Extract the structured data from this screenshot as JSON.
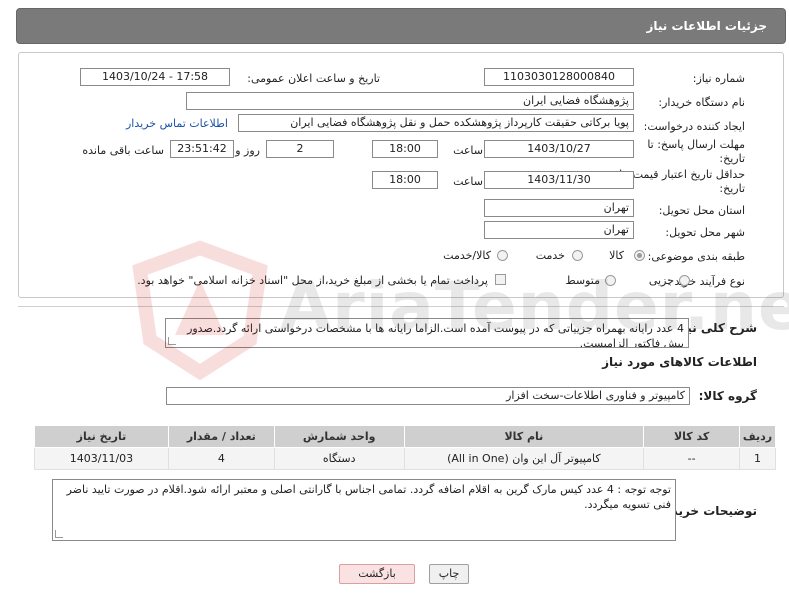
{
  "header": {
    "title": "جزئیات اطلاعات نیاز"
  },
  "fields": {
    "need_number_label": "شماره نیاز:",
    "need_number": "1103030128000840",
    "announce_label": "تاریخ و ساعت اعلان عمومی:",
    "announce_value": "1403/10/24 - 17:58",
    "buyer_label": "نام دستگاه خریدار:",
    "buyer_value": "پژوهشگاه فضایی ایران",
    "creator_label": "ایجاد کننده درخواست:",
    "creator_value": "پویا برکاتی حقیقت کارپرداز پژوهشکده حمل و نقل پژوهشگاه فضایی ایران",
    "contact_link": "اطلاعات تماس خریدار",
    "deadline_label_1": "مهلت ارسال پاسخ: تا",
    "deadline_label_2": "تاریخ:",
    "deadline_date": "1403/10/27",
    "time_label": "ساعت",
    "deadline_time": "18:00",
    "days_value": "2",
    "days_label": "روز و",
    "remaining_value": "23:51:42",
    "remaining_label": "ساعت باقی مانده",
    "validity_label_1": "حداقل تاریخ اعتبار قیمت: تا",
    "validity_label_2": "تاریخ:",
    "validity_date": "1403/11/30",
    "validity_time_label": "ساعت",
    "validity_time": "18:00",
    "province_label": "استان محل تحویل:",
    "province_value": "تهران",
    "city_label": "شهر محل تحویل:",
    "city_value": "تهران",
    "category_label": "طبقه بندی موضوعی:",
    "category_options": [
      "کالا",
      "خدمت",
      "کالا/خدمت"
    ],
    "process_label": "نوع فرآیند خرید :",
    "process_options": [
      "جزیی",
      "متوسط"
    ],
    "payment_note": "پرداخت تمام یا بخشی از مبلغ خرید،از محل \"اسناد خزانه اسلامی\" خواهد بود."
  },
  "description": {
    "label": "شرح کلی نیاز:",
    "text": "4 عدد رایانه بهمراه جزییاتی که در پیوست آمده است.الزاما رایانه ها با مشخصات درخواستی ارائه گردد.صدور پیش فاکتور الزامیست."
  },
  "goods": {
    "section_title": "اطلاعات کالاهای مورد نیاز",
    "group_label": "گروه کالا:",
    "group_value": "کامپیوتر و فناوری اطلاعات-سخت افزار",
    "columns": [
      "ردیف",
      "کد کالا",
      "نام کالا",
      "واحد شمارش",
      "تعداد / مقدار",
      "تاریخ نیاز"
    ],
    "rows": [
      [
        "1",
        "--",
        "کامپیوتر آل این وان (All in One)",
        "دستگاه",
        "4",
        "1403/11/03"
      ]
    ]
  },
  "buyer_notes": {
    "label": "توضیحات خریدار:",
    "text": "توجه توجه : 4 عدد کیس مارک گرین به اقلام اضافه گردد. تمامی اجناس با گارانتی اصلی و معتبر ارائه شود.اقلام در صورت تایید ناضر فنی تسویه میگردد."
  },
  "buttons": {
    "print": "چاپ",
    "back": "بازگشت"
  },
  "watermark": {
    "text": "AriaTender.neT"
  }
}
